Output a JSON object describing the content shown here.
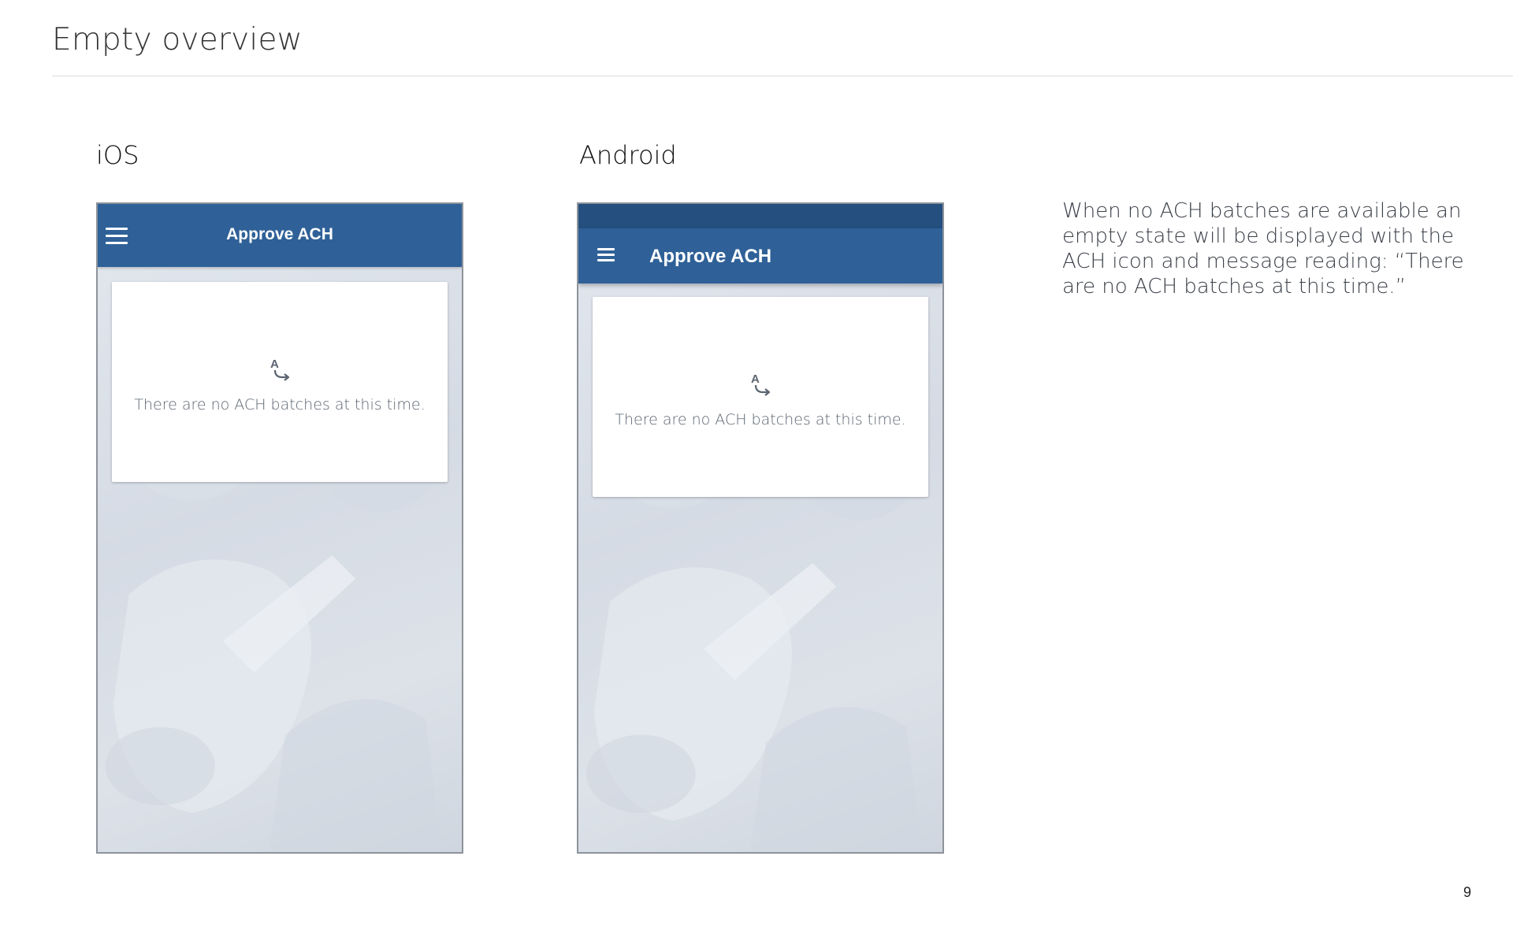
{
  "page": {
    "title": "Empty overview",
    "page_number": "9"
  },
  "ios": {
    "label": "iOS",
    "app_title": "Approve ACH",
    "empty_message": "There are no ACH batches at this time."
  },
  "android": {
    "label": "Android",
    "app_title": "Approve ACH",
    "empty_message": "There are no ACH batches at this time."
  },
  "description": "When no ACH batches are available an empty state will be displayed with the ACH icon and message reading: “There are no ACH batches at this time.”",
  "colors": {
    "app_bar": "#2f6198",
    "status_bar": "#244f7e",
    "icon": "#5b6470"
  },
  "icons": {
    "menu": "hamburger-menu-icon",
    "empty_state": "ach-transfer-icon"
  }
}
